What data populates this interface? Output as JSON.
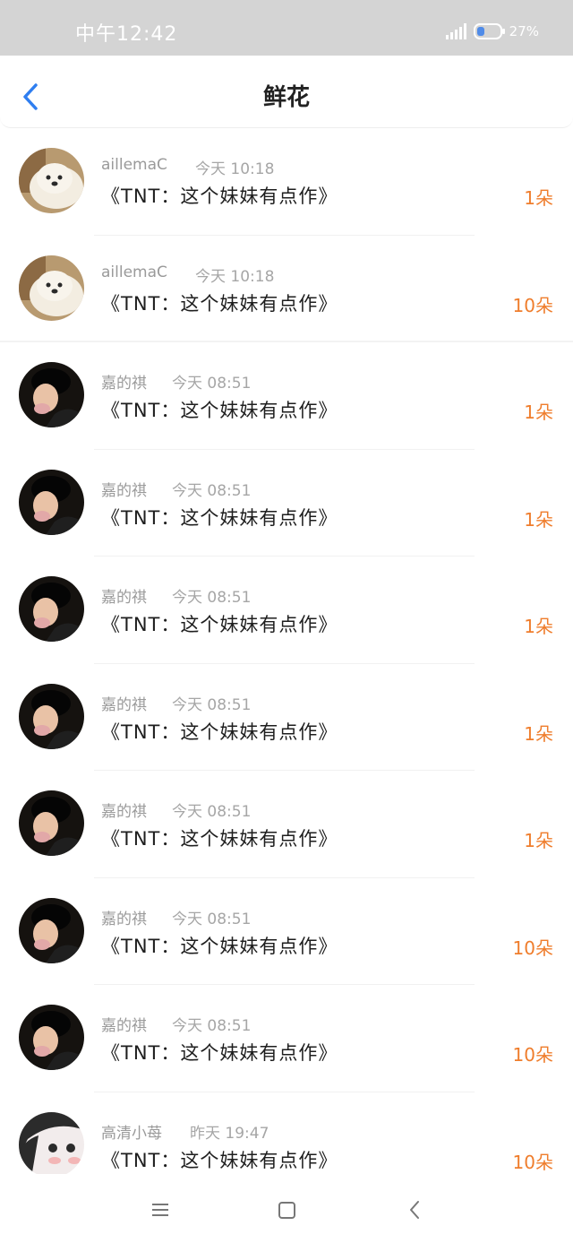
{
  "status_bar": {
    "time": "中午12:42",
    "battery": "27%"
  },
  "header": {
    "title": "鲜花"
  },
  "items": [
    {
      "avatar": "dog",
      "name": "aillemaC",
      "time": "今天 10:18",
      "book": "《TNT：这个妹妹有点作》",
      "count": "1朵"
    },
    {
      "avatar": "dog",
      "name": "aillemaC",
      "time": "今天 10:18",
      "book": "《TNT：这个妹妹有点作》",
      "count": "10朵"
    },
    {
      "avatar": "boy",
      "name": "嘉的祺",
      "time": "今天 08:51",
      "book": "《TNT：这个妹妹有点作》",
      "count": "1朵"
    },
    {
      "avatar": "boy",
      "name": "嘉的祺",
      "time": "今天 08:51",
      "book": "《TNT：这个妹妹有点作》",
      "count": "1朵"
    },
    {
      "avatar": "boy",
      "name": "嘉的祺",
      "time": "今天 08:51",
      "book": "《TNT：这个妹妹有点作》",
      "count": "1朵"
    },
    {
      "avatar": "boy",
      "name": "嘉的祺",
      "time": "今天 08:51",
      "book": "《TNT：这个妹妹有点作》",
      "count": "1朵"
    },
    {
      "avatar": "boy",
      "name": "嘉的祺",
      "time": "今天 08:51",
      "book": "《TNT：这个妹妹有点作》",
      "count": "1朵"
    },
    {
      "avatar": "boy",
      "name": "嘉的祺",
      "time": "今天 08:51",
      "book": "《TNT：这个妹妹有点作》",
      "count": "10朵"
    },
    {
      "avatar": "boy",
      "name": "嘉的祺",
      "time": "今天 08:51",
      "book": "《TNT：这个妹妹有点作》",
      "count": "10朵"
    },
    {
      "avatar": "girl",
      "name": "高清小苺",
      "time": "昨天 19:47",
      "book": "《TNT：这个妹妹有点作》",
      "count": "10朵"
    }
  ],
  "colors": {
    "accent": "#2f7ef0",
    "count": "#ef7d2c"
  }
}
